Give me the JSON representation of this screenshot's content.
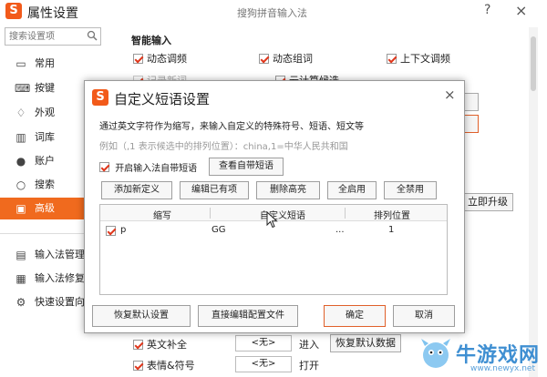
{
  "window": {
    "title": "属性设置",
    "center_title": "搜狗拼音输入法",
    "help_label": "?",
    "close_label": "×",
    "logo_letter": "S"
  },
  "search": {
    "placeholder": "搜索设置项"
  },
  "sidebar": {
    "items": [
      {
        "label": "常用",
        "icon": "monitor-icon",
        "glyph": "▭"
      },
      {
        "label": "按键",
        "icon": "keyboard-icon",
        "glyph": "⌨"
      },
      {
        "label": "外观",
        "icon": "shirt-icon",
        "glyph": "♢"
      },
      {
        "label": "词库",
        "icon": "book-icon",
        "glyph": "▥"
      },
      {
        "label": "账户",
        "icon": "user-icon",
        "glyph": "●"
      },
      {
        "label": "搜索",
        "icon": "search-icon",
        "glyph": "○"
      },
      {
        "label": "高级",
        "icon": "advanced-icon",
        "glyph": "▣"
      }
    ],
    "bottom_items": [
      {
        "label": "输入法管理",
        "icon": "manage-icon",
        "glyph": "▤"
      },
      {
        "label": "输入法修复",
        "icon": "repair-icon",
        "glyph": "▦"
      },
      {
        "label": "快速设置向",
        "icon": "wizard-icon",
        "glyph": "⚙"
      }
    ]
  },
  "main": {
    "section_title": "智能输入",
    "options": [
      {
        "label": "动态调频",
        "checked": true
      },
      {
        "label": "动态组词",
        "checked": true
      },
      {
        "label": "上下文调频",
        "checked": true
      },
      {
        "label": "记录新词",
        "checked": true,
        "disabled": true
      },
      {
        "label": "云计算候选",
        "checked": true
      }
    ],
    "upgrade_button": "立即升级",
    "bottom_rows": [
      {
        "label": "英文补全",
        "value": "<无>",
        "action": "进入",
        "button": "恢复默认数据"
      },
      {
        "label": "表情&符号",
        "value": "<无>",
        "action": "打开"
      }
    ]
  },
  "dialog": {
    "title": "自定义短语设置",
    "close_label": "×",
    "description": "通过英文字符作为缩写，来输入自定义的特殊符号、短语、短文等",
    "example": "例如（,1 表示候选中的排列位置）：china,1=中华人民共和国",
    "enable_label": "开启输入法自带短语",
    "enable_checked": true,
    "view_button": "查看自带短语",
    "toolbar": [
      "添加新定义",
      "编辑已有项",
      "删除高亮",
      "全启用",
      "全禁用"
    ],
    "table": {
      "columns": [
        "缩写",
        "自定义短语",
        "排列位置"
      ],
      "rows": [
        {
          "checked": true,
          "abbr": "p",
          "phrase": "GG",
          "ellipsis": "...",
          "position": "1"
        }
      ]
    },
    "footer": {
      "restore": "恢复默认设置",
      "edit_config": "直接编辑配置文件",
      "ok": "确定",
      "cancel": "取消"
    }
  },
  "watermark": {
    "text": "牛游戏网",
    "sub": "www.newyx.net"
  },
  "colors": {
    "accent": "#f06a1e",
    "check": "#e0361b"
  }
}
